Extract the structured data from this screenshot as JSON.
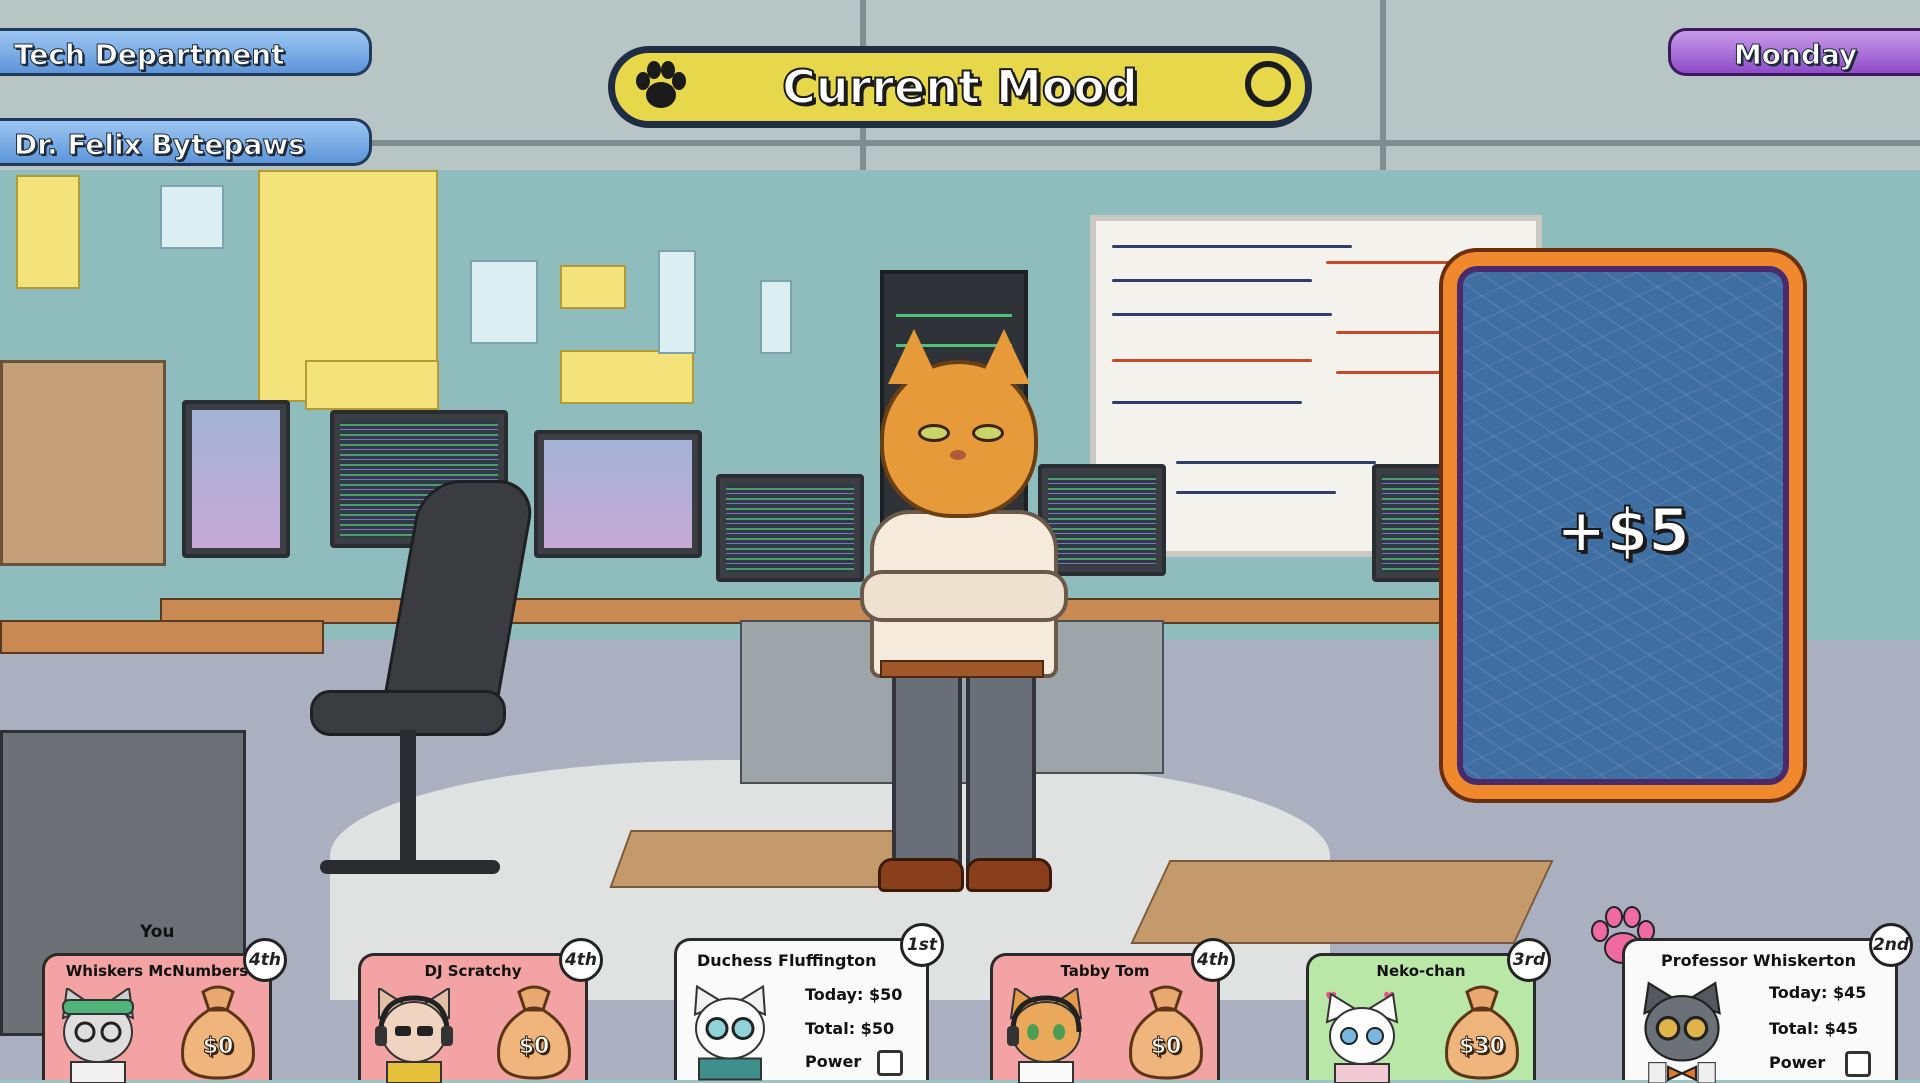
{
  "hud": {
    "department": "Tech Department",
    "boss_name": "Dr. Felix Bytepaws",
    "day": "Monday",
    "mood_title": "Current Mood"
  },
  "card": {
    "value": "+$5"
  },
  "you_label": "You",
  "players": [
    {
      "name": "Whiskers McNumbers",
      "rank": "4th",
      "money": "$0",
      "bg": "#f3a3a3"
    },
    {
      "name": "DJ Scratchy",
      "rank": "4th",
      "money": "$0",
      "bg": "#f3a3a3"
    },
    {
      "name": "Duchess Fluffington",
      "rank": "1st",
      "today": "Today: $50",
      "total": "Total: $50",
      "power_label": "Power",
      "power_checked": false
    },
    {
      "name": "Tabby Tom",
      "rank": "4th",
      "money": "$0",
      "bg": "#f3a3a3"
    },
    {
      "name": "Neko-chan",
      "rank": "3rd",
      "money": "$30",
      "bg": "#b9e7a8"
    },
    {
      "name": "Professor Whiskerton",
      "rank": "2nd",
      "today": "Today: $45",
      "total": "Total: $45",
      "power_label": "Power",
      "power_checked": false
    }
  ],
  "colors": {
    "mood_bar": "#e6d84a",
    "tag_blue": "#5d95d9",
    "tag_purple": "#8e4cc9",
    "card_border": "#f0892e",
    "card_face": "#3f6ea3"
  },
  "icons": [
    "paw-icon",
    "mood-indicator-circle",
    "money-bag-icon",
    "pink-paw-icon"
  ]
}
